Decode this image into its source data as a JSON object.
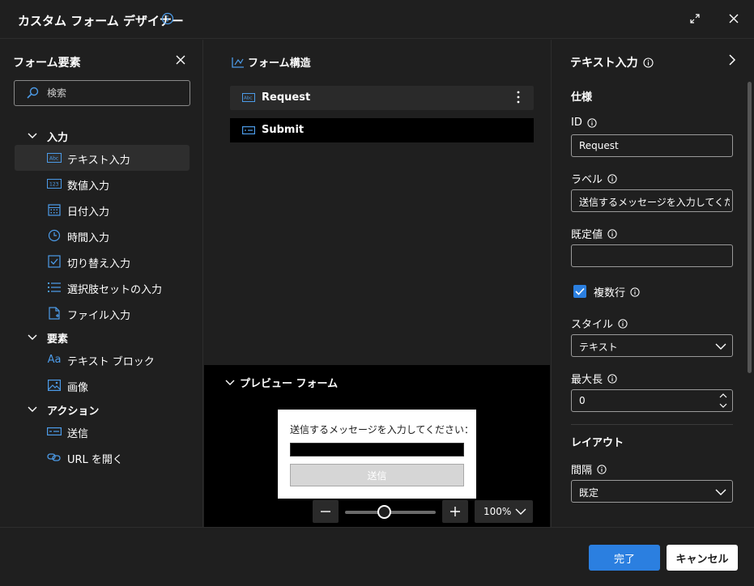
{
  "dialog": {
    "title": "カスタム フォーム デザイナー"
  },
  "elements_panel": {
    "title": "フォーム要素",
    "search_placeholder": "検索",
    "groups": [
      {
        "label": "入力",
        "items": [
          {
            "label": "テキスト入力",
            "icon": "text-input-icon"
          },
          {
            "label": "数値入力",
            "icon": "number-input-icon"
          },
          {
            "label": "日付入力",
            "icon": "calendar-icon"
          },
          {
            "label": "時間入力",
            "icon": "clock-icon"
          },
          {
            "label": "切り替え入力",
            "icon": "toggle-check-icon"
          },
          {
            "label": "選択肢セットの入力",
            "icon": "list-icon"
          },
          {
            "label": "ファイル入力",
            "icon": "file-icon"
          }
        ]
      },
      {
        "label": "要素",
        "items": [
          {
            "label": "テキスト ブロック",
            "icon": "text-block-icon",
            "glyph": "Aa"
          },
          {
            "label": "画像",
            "icon": "image-icon"
          }
        ]
      },
      {
        "label": "アクション",
        "items": [
          {
            "label": "送信",
            "icon": "submit-icon"
          },
          {
            "label": "URL を開く",
            "icon": "link-icon"
          }
        ]
      }
    ]
  },
  "structure": {
    "title": "フォーム構造",
    "rows": [
      {
        "label": "Request",
        "icon": "text-input-icon"
      },
      {
        "label": "Submit",
        "icon": "submit-icon"
      }
    ]
  },
  "preview": {
    "title": "プレビュー フォーム",
    "form_label": "送信するメッセージを入力してください：",
    "submit_label": "送信",
    "zoom": "100%",
    "zoom_level": 0.4
  },
  "properties": {
    "title": "テキスト入力",
    "section_spec": "仕様",
    "id_label": "ID",
    "id_value": "Request",
    "label_label": "ラベル",
    "label_value": "送信するメッセージを入力してください：",
    "default_label": "既定値",
    "default_value": "",
    "multiline_label": "複数行",
    "multiline_checked": true,
    "style_label": "スタイル",
    "style_value": "テキスト",
    "maxlen_label": "最大長",
    "maxlen_value": "0",
    "section_layout": "レイアウト",
    "spacing_label": "間隔",
    "spacing_value": "既定"
  },
  "footer": {
    "ok_label": "完了",
    "cancel_label": "キャンセル"
  },
  "colors": {
    "accent": "#2b7fe0",
    "background": "#1f1f1f",
    "icon": "#4c9be8"
  }
}
